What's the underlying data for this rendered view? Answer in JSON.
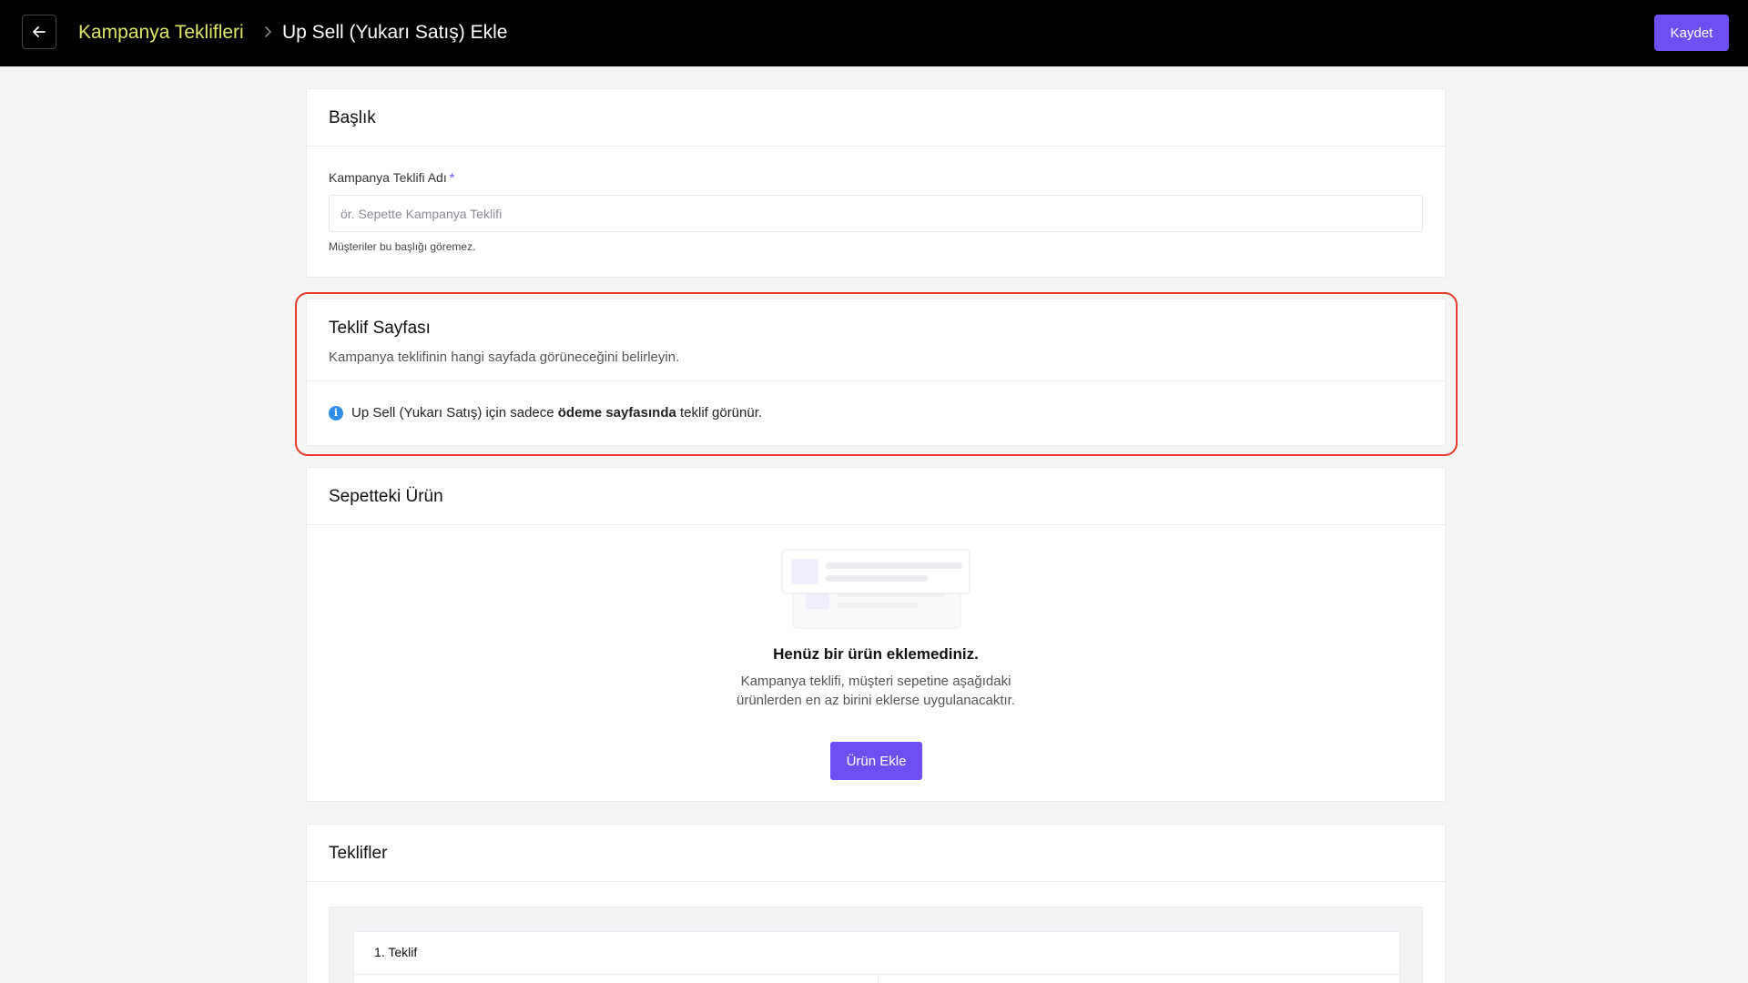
{
  "header": {
    "back_icon": "arrow-left-icon",
    "breadcrumb_parent": "Kampanya Teklifleri",
    "breadcrumb_current": "Up Sell (Yukarı Satış) Ekle",
    "save_label": "Kaydet",
    "accent": "#6f4ff2",
    "crumb_color": "#dfe86a"
  },
  "title_card": {
    "title": "Başlık",
    "field_label": "Kampanya Teklifi Adı",
    "required_mark": "*",
    "field_value": "",
    "field_placeholder": "ör. Sepette Kampanya Teklifi",
    "hint": "Müşteriler bu başlığı göremez."
  },
  "offer_page_card": {
    "title": "Teklif Sayfası",
    "description": "Kampanya teklifinin hangi sayfada görüneceğini belirleyin.",
    "info_prefix": "Up Sell (Yukarı Satış) için sadece ",
    "info_bold": "ödeme sayfasında",
    "info_suffix": " teklif görünür.",
    "highlight_color": "#e8392d"
  },
  "cart_product_card": {
    "title": "Sepetteki Ürün",
    "empty_title": "Henüz bir ürün eklemediniz.",
    "empty_desc_line1": "Kampanya teklifi, müşteri sepetine aşağıdaki",
    "empty_desc_line2": "ürünlerden en az birini eklerse uygulanacaktır.",
    "add_button": "Ürün Ekle"
  },
  "offers_card": {
    "title": "Teklifler",
    "items": [
      {
        "label": "1. Teklif"
      }
    ]
  }
}
